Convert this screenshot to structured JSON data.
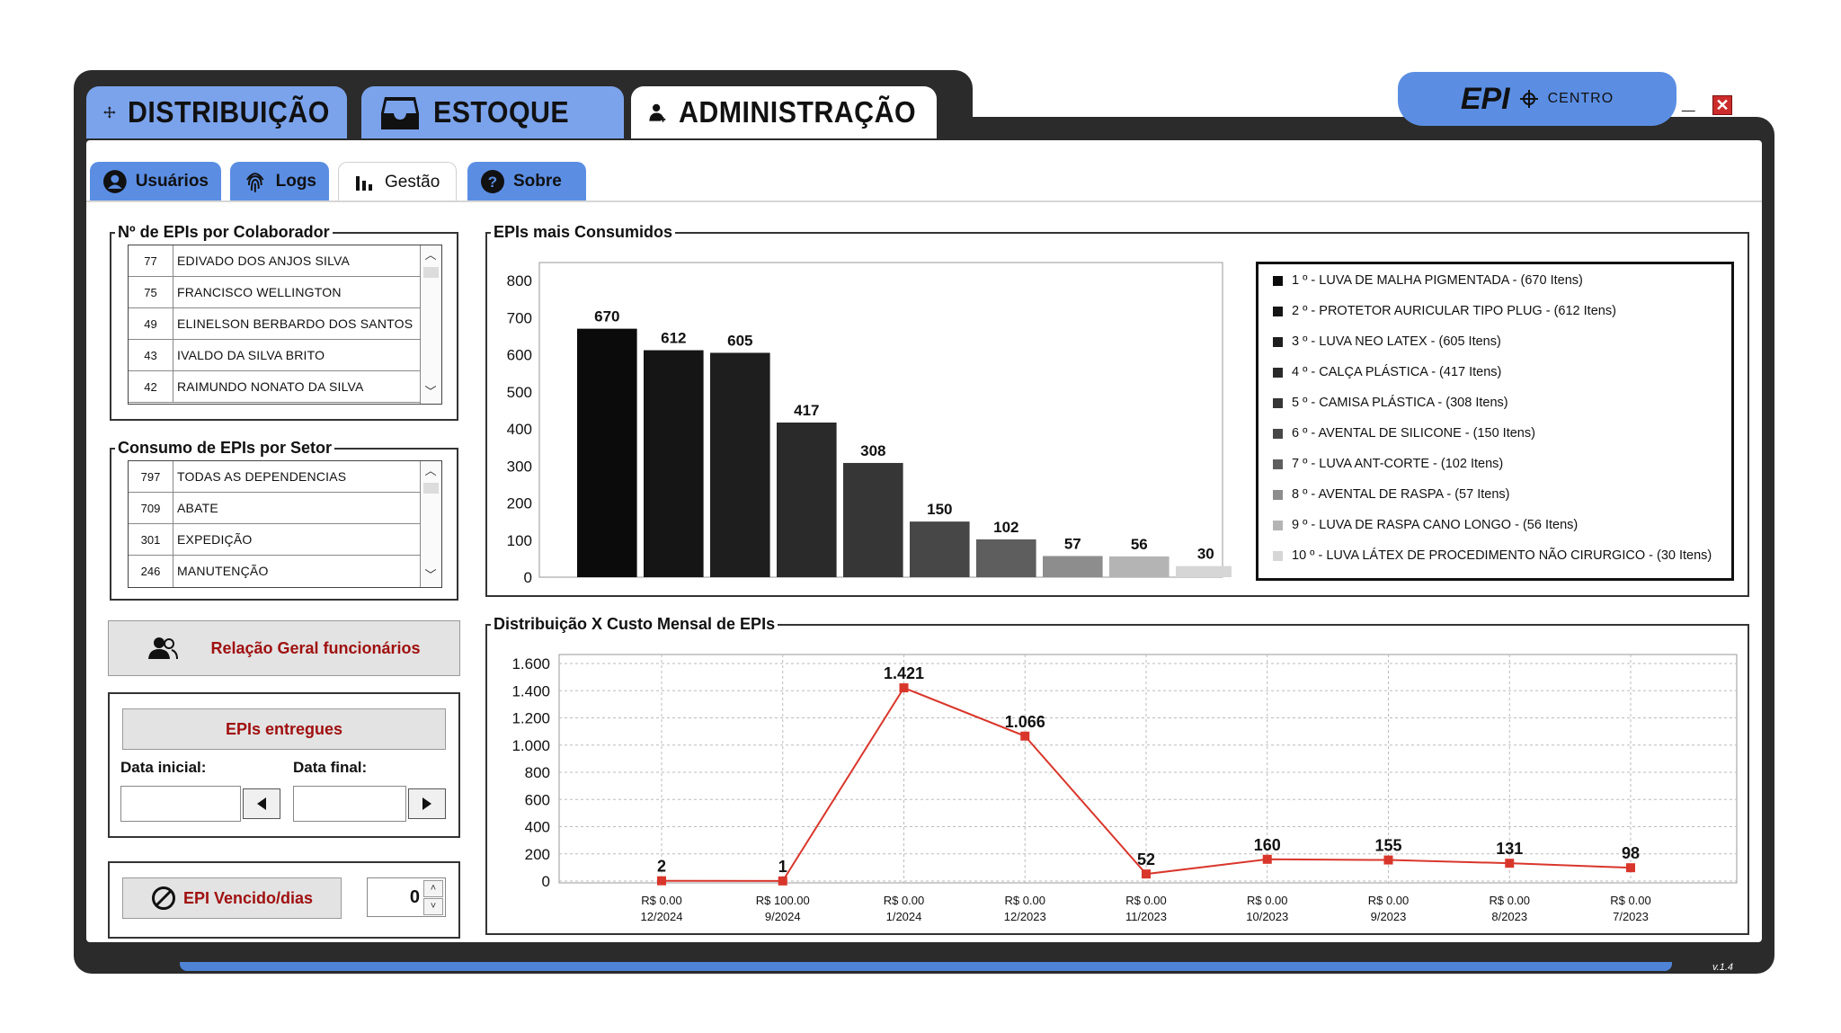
{
  "app": {
    "brand_epi": "EPI",
    "brand_centro": "CENTRO",
    "version": "v.1.4"
  },
  "main_tabs": [
    {
      "label": "DISTRIBUIÇÃO",
      "icon": "move-arrows-icon"
    },
    {
      "label": "ESTOQUE",
      "icon": "inbox-tray-icon"
    },
    {
      "label": "ADMINISTRAÇÃO",
      "icon": "user-admin-icon",
      "active": true
    }
  ],
  "sub_tabs": [
    {
      "label": "Usuários",
      "icon": "user-circle-icon"
    },
    {
      "label": "Logs",
      "icon": "fingerprint-icon"
    },
    {
      "label": "Gestão",
      "icon": "bar-chart-icon",
      "active": true
    },
    {
      "label": "Sobre",
      "icon": "help-circle-icon"
    }
  ],
  "por_colaborador": {
    "title": "Nº de EPIs  por Colaborador",
    "rows": [
      {
        "n": "77",
        "name": "EDIVADO DOS ANJOS SILVA"
      },
      {
        "n": "75",
        "name": "FRANCISCO WELLINGTON"
      },
      {
        "n": "49",
        "name": "ELINELSON BERBARDO DOS SANTOS"
      },
      {
        "n": "43",
        "name": "IVALDO DA SILVA BRITO"
      },
      {
        "n": "42",
        "name": "RAIMUNDO NONATO DA SILVA"
      }
    ]
  },
  "por_setor": {
    "title": "Consumo de EPIs por Setor",
    "rows": [
      {
        "n": "797",
        "name": "TODAS AS DEPENDENCIAS"
      },
      {
        "n": "709",
        "name": "ABATE"
      },
      {
        "n": "301",
        "name": "EXPEDIÇÃO"
      },
      {
        "n": "246",
        "name": "MANUTENÇÃO"
      }
    ]
  },
  "buttons": {
    "relacao": "Relação Geral funcionários",
    "entregues": "EPIs entregues",
    "vencido": "EPI Vencido/dias"
  },
  "dates": {
    "inicial_label": "Data inicial:",
    "final_label": "Data final:",
    "inicial_value": "",
    "final_value": ""
  },
  "spinner_value": "0",
  "colors": {
    "tab_blue": "#7ba3ec",
    "subtab_blue": "#5b8ee3",
    "accent_red": "#a01010",
    "line_red": "#d9362b"
  },
  "chart_data": [
    {
      "type": "bar",
      "title": "EPIs mais Consumidos",
      "categories": [
        "1 º - LUVA DE MALHA PIGMENTADA - (670 Itens)",
        "2 º - PROTETOR AURICULAR TIPO PLUG - (612 Itens)",
        "3 º - LUVA NEO LATEX - (605 Itens)",
        "4 º - CALÇA PLÁSTICA - (417 Itens)",
        "5 º - CAMISA PLÁSTICA - (308 Itens)",
        "6 º - AVENTAL DE SILICONE - (150 Itens)",
        "7 º - LUVA ANT-CORTE - (102 Itens)",
        "8 º - AVENTAL DE RASPA - (57 Itens)",
        "9 º - LUVA DE RASPA CANO LONGO - (56 Itens)",
        "10 º - LUVA LÁTEX DE PROCEDIMENTO NÃO CIRURGICO - (30 Itens)"
      ],
      "values": [
        670,
        612,
        605,
        417,
        308,
        150,
        102,
        57,
        56,
        30
      ],
      "bar_colors": [
        "#0b0b0b",
        "#151515",
        "#1e1e1e",
        "#2a2a2a",
        "#363636",
        "#474747",
        "#5e5e5e",
        "#8d8d8d",
        "#b4b4b4",
        "#d6d6d6"
      ],
      "yticks": [
        "0",
        "100",
        "200",
        "300",
        "400",
        "500",
        "600",
        "700",
        "800"
      ],
      "ylim": [
        0,
        800
      ],
      "legend": "right"
    },
    {
      "type": "line",
      "title": "Distribuição X Custo Mensal de EPIs",
      "x": [
        "12/2024",
        "9/2024",
        "1/2024",
        "12/2023",
        "11/2023",
        "10/2023",
        "9/2023",
        "8/2023",
        "7/2023"
      ],
      "cost_labels": [
        "R$ 0.00",
        "R$ 100.00",
        "R$ 0.00",
        "R$ 0.00",
        "R$ 0.00",
        "R$ 0.00",
        "R$ 0.00",
        "R$ 0.00",
        "R$ 0.00"
      ],
      "values": [
        2,
        1,
        1421,
        1066,
        52,
        160,
        155,
        131,
        98
      ],
      "value_labels": [
        "2",
        "1",
        "1.421",
        "1.066",
        "52",
        "160",
        "155",
        "131",
        "98"
      ],
      "yticks": [
        "0",
        "200",
        "400",
        "600",
        "800",
        "1.000",
        "1.200",
        "1.400",
        "1.600"
      ],
      "ylim": [
        0,
        1600
      ],
      "grid": true
    }
  ]
}
